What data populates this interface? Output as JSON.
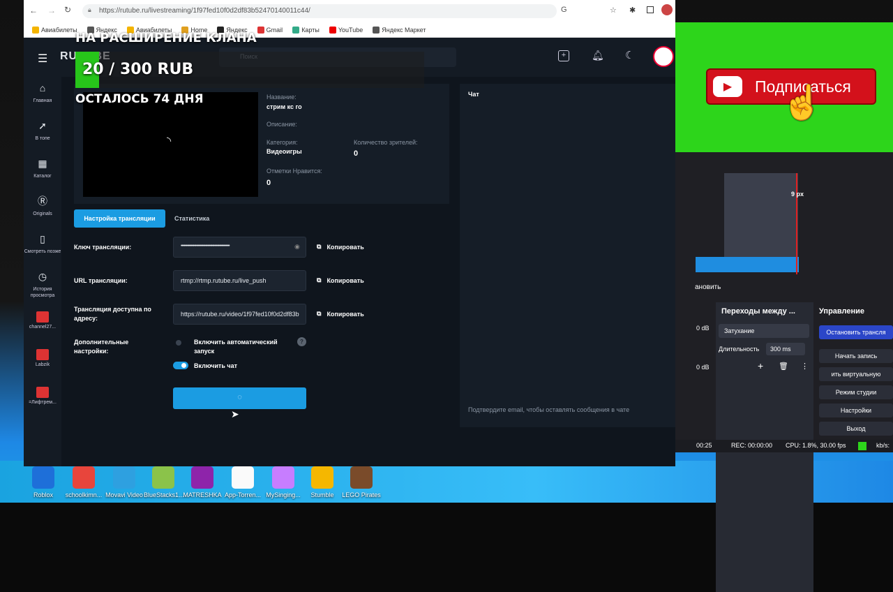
{
  "browser": {
    "url": "https://rutube.ru/livestreaming/1f97fed10f0d2df83b52470140011c44/",
    "bookmarks": [
      "Авиабилеты",
      "Яндекс",
      "Авиабилеты",
      "Home",
      "Яндекс",
      "Gmail",
      "Карты",
      "YouTube",
      "Яндекс Маркет"
    ]
  },
  "overlay": {
    "line1": "НА РАСШИРЕНИЕ КЛАНА",
    "line2": "20 / 300 RUB",
    "line3": "ОСТАЛОСЬ 74 ДНЯ"
  },
  "rutube": {
    "logo": "RUTUBE",
    "search_placeholder": "Поиск",
    "sidebar": [
      {
        "icon": "home-icon",
        "glyph": "⌂",
        "label": "Главная"
      },
      {
        "icon": "rocket-icon",
        "glyph": "➚",
        "label": "В топе"
      },
      {
        "icon": "catalog-icon",
        "glyph": "▦",
        "label": "Каталог"
      },
      {
        "icon": "originals-icon",
        "glyph": "Ⓡ",
        "label": "Originals"
      },
      {
        "icon": "bookmark-icon",
        "glyph": "▯",
        "label": "Смотреть позже"
      },
      {
        "icon": "history-icon",
        "glyph": "◷",
        "label": "История просмотра"
      },
      {
        "icon": "channel-icon",
        "glyph": "",
        "label": "channel27..."
      },
      {
        "icon": "channel-icon",
        "glyph": "",
        "label": "Labzik"
      },
      {
        "icon": "channel-icon",
        "glyph": "",
        "label": "=Лифтрем..."
      }
    ],
    "info": {
      "name_label": "Название:",
      "name_value": "стрим кс го",
      "desc_label": "Описание:",
      "cat_label": "Категория:",
      "cat_value": "Видеоигры",
      "viewers_label": "Количество зрителей:",
      "viewers_value": "0",
      "likes_label": "Отметки Нравится:",
      "likes_value": "0"
    },
    "tabs": {
      "settings": "Настройка трансляции",
      "stats": "Статистика"
    },
    "form": {
      "key_label": "Ключ трансляции:",
      "key_value": "••••••••••••••••••••••••••••••••••••••••••••••••",
      "url_label": "URL трансляции:",
      "url_value": "rtmp://rtmp.rutube.ru/live_push",
      "addr_label": "Трансляция доступна по адресу:",
      "addr_value": "https://rutube.ru/video/1f97fed10f0d2df83b",
      "copy": "Копировать",
      "extra_label": "Дополнительные настройки:",
      "auto_label": "Включить автоматический запуск",
      "chat_label": "Включить чат"
    },
    "chat": {
      "title": "Чат",
      "hint": "Подтвердите email, чтобы оставлять сообщения в чате"
    }
  },
  "subscribe": {
    "label": "Подписаться"
  },
  "obs": {
    "transitions_title": "Переходы между ...",
    "controls_title": "Управление",
    "fade": "Затухание",
    "duration_label": "Длительность",
    "duration_value": "300 ms",
    "refresh": "ановить",
    "px": "9 px",
    "db1": "0 dB",
    "db2": "0 dB",
    "buttons": [
      "Остановить трансля",
      "Начать запись",
      "ить виртуальную",
      "Режим студии",
      "Настройки",
      "Выход"
    ],
    "status": {
      "time": "00:25",
      "rec": "REC: 00:00:00",
      "cpu": "CPU: 1.8%, 30.00 fps",
      "kbs": "kb/s:"
    }
  },
  "taskbar": [
    "Roblox",
    "schoolkimn...",
    "Movavi Video",
    "BlueStacks1...",
    "MATRESHKA",
    "App-Torren...",
    "MySinging...",
    "Stumble",
    "LEGO Pirates"
  ]
}
